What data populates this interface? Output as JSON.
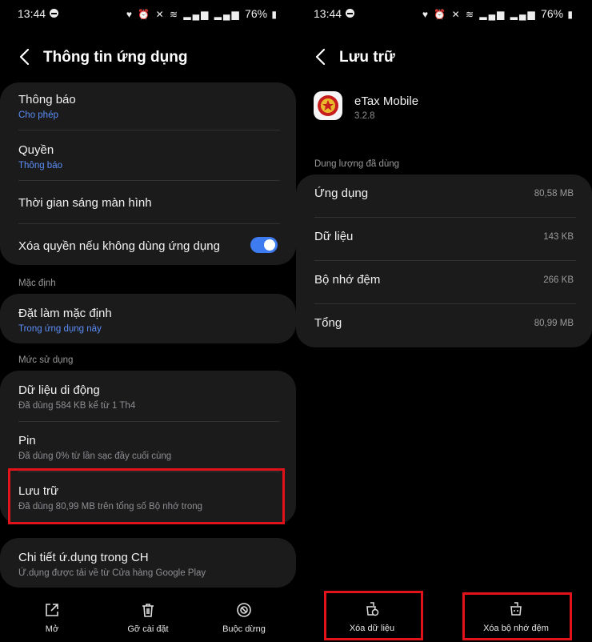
{
  "status": {
    "time": "13:44",
    "battery": "76%"
  },
  "left": {
    "title": "Thông tin ứng dụng",
    "rows1": [
      {
        "main": "Thông báo",
        "sub": "Cho phép"
      },
      {
        "main": "Quyền",
        "sub": "Thông báo"
      },
      {
        "main": "Thời gian sáng màn hình"
      },
      {
        "main": "Xóa quyền nếu không dùng ứng dụng",
        "toggle": "on"
      }
    ],
    "section_default": "Mặc định",
    "default_row": {
      "main": "Đặt làm mặc định",
      "sub": "Trong ứng dụng này"
    },
    "section_usage": "Mức sử dụng",
    "usage_rows": [
      {
        "main": "Dữ liệu di động",
        "sub": "Đã dùng 584 KB kể từ 1 Th4"
      },
      {
        "main": "Pin",
        "sub": "Đã dùng 0% từ lần sạc đầy cuối cùng"
      },
      {
        "main": "Lưu trữ",
        "sub": "Đã dùng 80,99 MB trên tổng số Bộ nhớ trong"
      }
    ],
    "store_row": {
      "main": "Chi tiết ứ.dụng trong CH",
      "sub": "Ứ.dụng được tải về từ Cửa hàng Google Play"
    },
    "bottom": {
      "open": "Mở",
      "uninstall": "Gỡ cài đặt",
      "force_stop": "Buộc dừng"
    }
  },
  "right": {
    "title": "Lưu trữ",
    "app_name": "eTax Mobile",
    "app_version": "3.2.8",
    "section_used": "Dung lượng đã dùng",
    "rows": [
      {
        "label": "Ứng dụng",
        "value": "80,58 MB"
      },
      {
        "label": "Dữ liệu",
        "value": "143 KB"
      },
      {
        "label": "Bộ nhớ đệm",
        "value": "266 KB"
      },
      {
        "label": "Tổng",
        "value": "80,99 MB"
      }
    ],
    "bottom": {
      "clear_data": "Xóa dữ liệu",
      "clear_cache": "Xóa bộ nhớ đệm"
    }
  },
  "colors": {
    "accent": "#3e7bf0",
    "link": "#5b8df6",
    "highlight": "#e0131b",
    "card": "#1b1b1c"
  }
}
